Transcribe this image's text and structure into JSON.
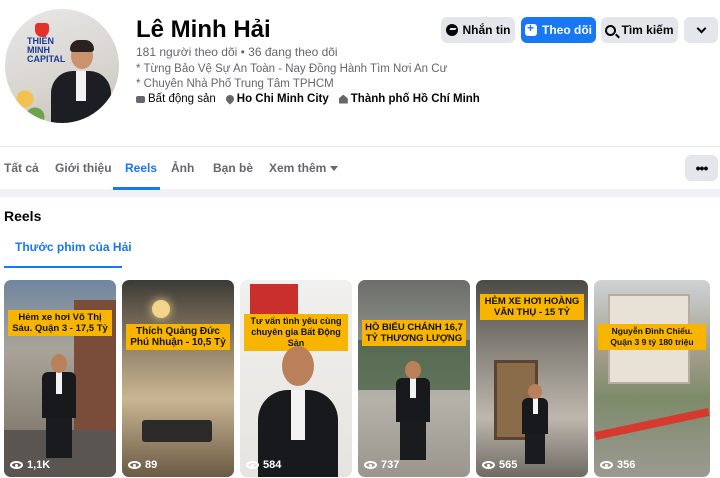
{
  "profile": {
    "name": "Lê Minh Hải",
    "followers_line": "181 người theo dõi • 36 đang theo dõi",
    "bio": [
      "* Từng Bảo Vệ Sự An Toàn - Nay Đồng Hành Tìm Nơi An Cư",
      "* Chuyên Nhà Phố Trung Tâm TPHCM"
    ],
    "info": {
      "category": "Bất động sản",
      "location": "Ho Chi Minh City",
      "hometown": "Thành phố Hồ Chí Minh"
    },
    "avatar_brand": "THIÊN MINH CAPITAL"
  },
  "actions": {
    "message": "Nhắn tin",
    "follow": "Theo dõi",
    "search": "Tìm kiếm"
  },
  "tabs": [
    {
      "label": "Tất cả"
    },
    {
      "label": "Giới thiệu"
    },
    {
      "label": "Reels",
      "active": true
    },
    {
      "label": "Ảnh"
    },
    {
      "label": "Bạn bè"
    },
    {
      "label": "Xem thêm"
    }
  ],
  "reels": {
    "title": "Reels",
    "subtab": "Thước phim của Hải",
    "items": [
      {
        "caption": "Hẻm xe hơi Võ Thị Sáu. Quận 3 - 17,5 Tỷ",
        "views": "1,1K"
      },
      {
        "caption": "Thích Quảng Đức Phú Nhuận - 10,5 Tỷ",
        "views": "89"
      },
      {
        "caption": "Tư vấn tình yêu cùng chuyên gia Bất Động Sản",
        "views": "584"
      },
      {
        "caption": "HỒ BIỂU CHÁNH 16,7 TỶ THƯƠNG LƯỢNG",
        "views": "737"
      },
      {
        "caption": "HẺM XE HƠI HOÀNG VĂN THỤ - 15 TỶ",
        "views": "565"
      },
      {
        "caption": "Nguyễn Đình Chiểu. Quận 3 9 tỷ 180 triệu",
        "views": "356"
      }
    ]
  },
  "colors": {
    "accent": "#1877f2",
    "caption_bg": "#f7b500",
    "page_bg": "#f0f2f5"
  }
}
